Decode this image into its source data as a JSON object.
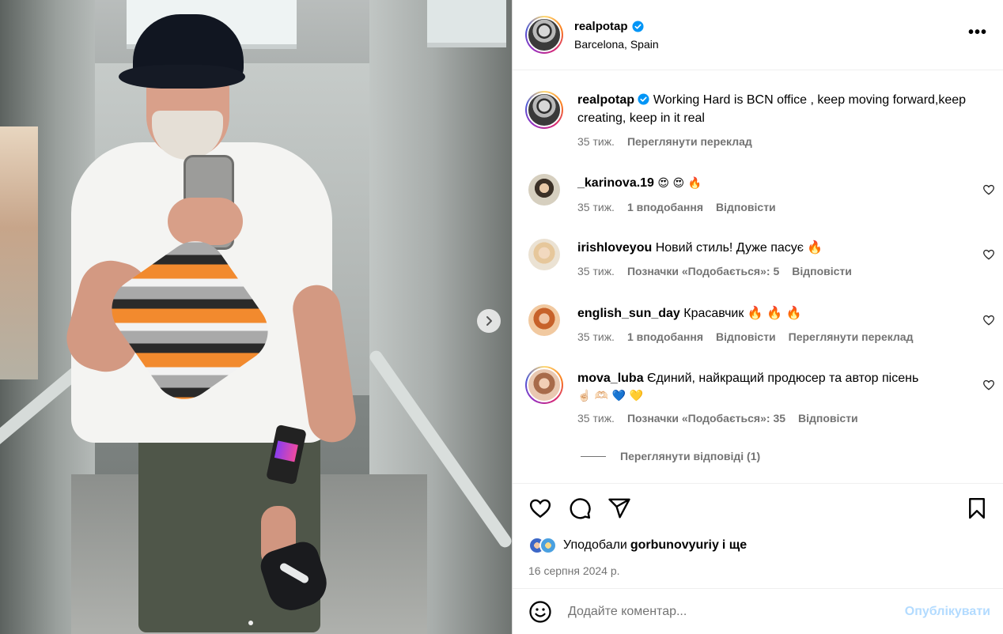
{
  "post": {
    "author": {
      "username": "realpotap",
      "location": "Barcelona, Spain",
      "verified": true
    },
    "more_label": "•••",
    "caption": {
      "username": "realpotap",
      "text": "Working Hard is BCN office , keep moving forward,keep creating, keep in it real",
      "time": "35 тиж.",
      "translate": "Переглянути переклад"
    },
    "comments": [
      {
        "username": "_karinova.19",
        "text": "😍 😍 🔥",
        "time": "35 тиж.",
        "likes": "1 вподобання",
        "reply": "Відповісти"
      },
      {
        "username": "irishloveyou",
        "text": "Новий стиль! Дуже пасує 🔥",
        "time": "35 тиж.",
        "likes": "Позначки «Подобається»: 5",
        "reply": "Відповісти"
      },
      {
        "username": "english_sun_day",
        "text": "Красавчик 🔥 🔥 🔥",
        "time": "35 тиж.",
        "likes": "1 вподобання",
        "reply": "Відповісти",
        "translate": "Переглянути переклад"
      },
      {
        "username": "mova_luba",
        "text": "Єдиний, найкращий продюсер та автор пісень",
        "text2": "☝🏻 🫶🏻 💙 💛",
        "time": "35 тиж.",
        "likes": "Позначки «Подобається»: 35",
        "reply": "Відповісти"
      }
    ],
    "view_replies": "Переглянути відповіді (1)",
    "liked_by": {
      "prefix": "Уподобали",
      "user": "gorbunovyuriy",
      "suffix": "і ще"
    },
    "date": "16 серпня 2024 р.",
    "comment_box": {
      "placeholder": "Додайте коментар...",
      "publish": "Опублікувати"
    }
  },
  "icons": {
    "like": "heart-icon",
    "comment": "comment-icon",
    "share": "share-icon",
    "save": "bookmark-icon",
    "emoji": "emoji-icon",
    "next": "chevron-right-icon",
    "verified": "verified-badge-icon"
  },
  "colors": {
    "verified": "#0095f6",
    "muted": "#737373",
    "publish_disabled": "#b3dbff"
  }
}
